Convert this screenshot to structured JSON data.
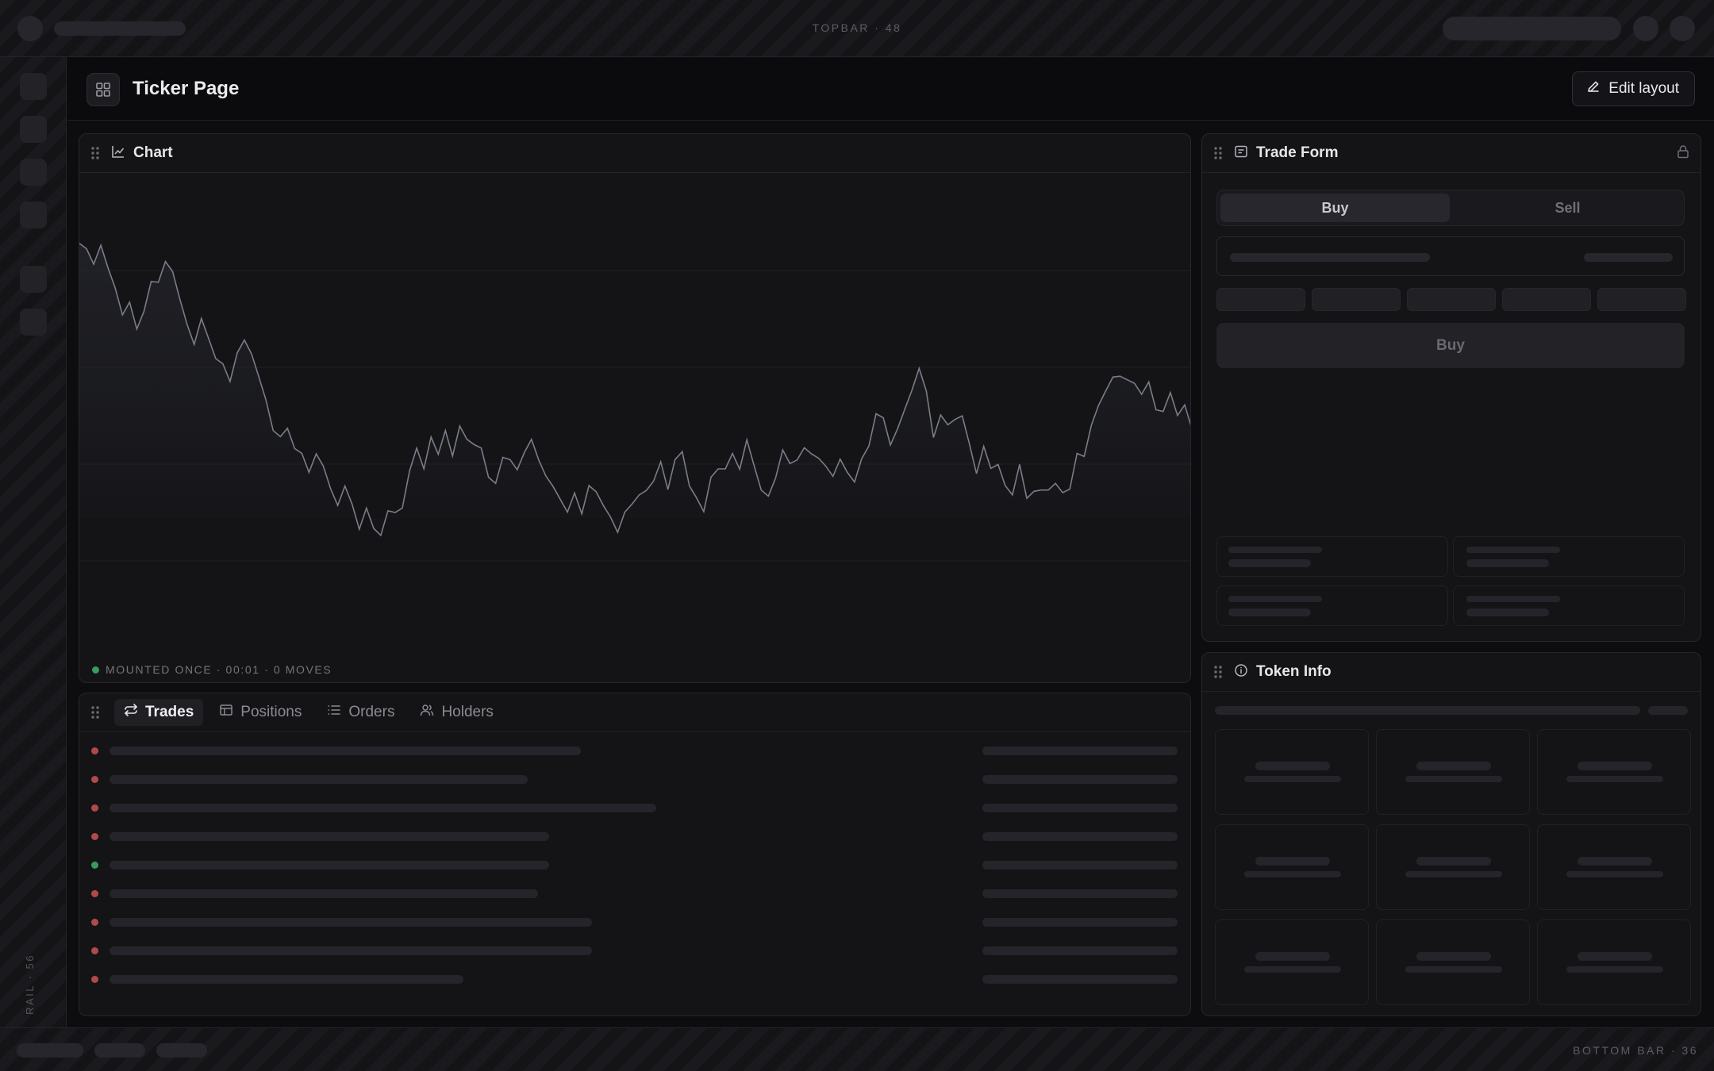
{
  "topbar": {
    "label": "TOPBAR · 48"
  },
  "rail": {
    "label": "RAIL · 56"
  },
  "bottombar": {
    "label": "BOTTOM BAR · 36"
  },
  "header": {
    "title": "Ticker Page",
    "edit_label": "Edit layout"
  },
  "chart_panel": {
    "title": "Chart",
    "status": "MOUNTED ONCE · 00:01 · 0 MOVES",
    "status_color": "#3b9a5b"
  },
  "bottom_panel": {
    "tabs": [
      {
        "label": "Trades",
        "icon": "swap-arrows-icon",
        "active": true
      },
      {
        "label": "Positions",
        "icon": "positions-icon",
        "active": false
      },
      {
        "label": "Orders",
        "icon": "list-icon",
        "active": false
      },
      {
        "label": "Holders",
        "icon": "users-icon",
        "active": false
      }
    ],
    "trade_rows": [
      {
        "side": "sell",
        "color": "#b04a4a",
        "width": 0.44
      },
      {
        "side": "sell",
        "color": "#b04a4a",
        "width": 0.39
      },
      {
        "side": "sell",
        "color": "#b04a4a",
        "width": 0.51
      },
      {
        "side": "sell",
        "color": "#b04a4a",
        "width": 0.41
      },
      {
        "side": "buy",
        "color": "#3b9a5b",
        "width": 0.41
      },
      {
        "side": "sell",
        "color": "#b04a4a",
        "width": 0.4
      },
      {
        "side": "sell",
        "color": "#b04a4a",
        "width": 0.45
      },
      {
        "side": "sell",
        "color": "#b04a4a",
        "width": 0.45
      },
      {
        "side": "sell",
        "color": "#b04a4a",
        "width": 0.33
      }
    ]
  },
  "trade_form": {
    "title": "Trade Form",
    "buy_tab": "Buy",
    "sell_tab": "Sell",
    "submit_label": "Buy",
    "lock_icon": "lock-icon"
  },
  "token_info": {
    "title": "Token Info"
  },
  "colors": {
    "accent_line": "#7a7d88",
    "sell": "#b04a4a",
    "buy": "#3b9a5b"
  },
  "chart_data": {
    "type": "line",
    "title": "",
    "xlabel": "",
    "ylabel": "",
    "grid": true,
    "ylim": [
      0,
      100
    ],
    "series": [
      {
        "values": [
          84.2,
          83.0,
          79.5,
          83.8,
          78.6,
          74.1,
          68.0,
          70.9,
          64.8,
          68.8,
          75.6,
          75.4,
          80.1,
          77.8,
          71.6,
          65.9,
          61.3,
          67.2,
          62.7,
          58.1,
          56.9,
          52.9,
          59.4,
          62.3,
          59.1,
          54.0,
          48.7,
          41.8,
          40.4,
          42.3,
          37.7,
          36.6,
          32.3,
          36.5,
          33.7,
          28.6,
          24.8,
          29.2,
          25.1,
          19.4,
          24.2,
          19.6,
          18.0,
          23.6,
          23.2,
          24.2,
          32.6,
          37.8,
          33.1,
          40.3,
          36.4,
          41.8,
          36.0,
          42.8,
          39.8,
          38.6,
          37.8,
          31.2,
          29.8,
          35.7,
          35.2,
          32.9,
          36.8,
          39.8,
          35.1,
          31.5,
          29.1,
          26.2,
          23.3,
          27.6,
          22.9,
          29.3,
          27.9,
          24.8,
          22.2,
          18.7,
          23.3,
          25.1,
          27.2,
          28.2,
          30.3,
          34.7,
          28.4,
          35.2,
          37.0,
          29.2,
          26.5,
          23.4,
          31.2,
          33.1,
          33.1,
          36.6,
          33.0,
          39.7,
          33.9,
          28.3,
          26.9,
          31.0,
          37.4,
          34.3,
          35.1,
          37.9,
          36.5,
          35.5,
          33.7,
          31.4,
          35.3,
          32.3,
          30.1,
          35.4,
          38.3,
          45.6,
          44.7,
          38.5,
          42.2,
          46.6,
          50.9,
          55.9,
          50.8,
          40.2,
          45.3,
          43.1,
          44.3,
          45.1,
          38.8,
          32.0,
          38.2,
          33.2,
          34.1,
          29.3,
          27.2,
          34.1,
          26.4,
          28.0,
          28.3,
          28.3,
          29.8,
          27.7,
          28.5,
          36.6,
          35.9,
          43.0,
          47.5,
          50.8,
          53.9,
          54.1,
          53.3,
          52.5,
          50.0,
          52.8,
          46.5,
          46.1,
          50.4,
          45.2,
          47.6,
          42.2
        ]
      }
    ]
  }
}
